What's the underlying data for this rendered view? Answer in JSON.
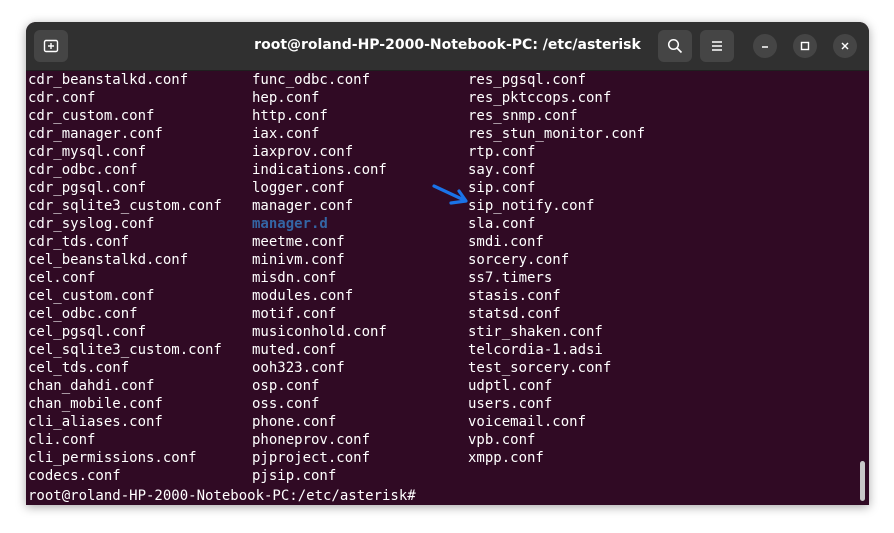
{
  "window": {
    "title": "root@roland-HP-2000-Notebook-PC: /etc/asterisk"
  },
  "icons": {
    "new_tab": "new-tab-icon",
    "search": "search-icon",
    "menu": "hamburger-menu-icon",
    "minimize": "minimize-icon",
    "maximize": "maximize-icon",
    "close": "close-icon"
  },
  "colors": {
    "terminal_bg": "#300a24",
    "titlebar_bg": "#303030",
    "directory_text": "#3465a4",
    "arrow": "#1a73e8"
  },
  "terminal": {
    "columns": [
      [
        "cdr_beanstalkd.conf",
        "cdr.conf",
        "cdr_custom.conf",
        "cdr_manager.conf",
        "cdr_mysql.conf",
        "cdr_odbc.conf",
        "cdr_pgsql.conf",
        "cdr_sqlite3_custom.conf",
        "cdr_syslog.conf",
        "cdr_tds.conf",
        "cel_beanstalkd.conf",
        "cel.conf",
        "cel_custom.conf",
        "cel_odbc.conf",
        "cel_pgsql.conf",
        "cel_sqlite3_custom.conf",
        "cel_tds.conf",
        "chan_dahdi.conf",
        "chan_mobile.conf",
        "cli_aliases.conf",
        "cli.conf",
        "cli_permissions.conf",
        "codecs.conf"
      ],
      [
        "func_odbc.conf",
        "hep.conf",
        "http.conf",
        "iax.conf",
        "iaxprov.conf",
        "indications.conf",
        "logger.conf",
        "manager.conf",
        "manager.d",
        "meetme.conf",
        "minivm.conf",
        "misdn.conf",
        "modules.conf",
        "motif.conf",
        "musiconhold.conf",
        "muted.conf",
        "ooh323.conf",
        "osp.conf",
        "oss.conf",
        "phone.conf",
        "phoneprov.conf",
        "pjproject.conf",
        "pjsip.conf"
      ],
      [
        "res_pgsql.conf",
        "res_pktccops.conf",
        "res_snmp.conf",
        "res_stun_monitor.conf",
        "rtp.conf",
        "say.conf",
        "sip.conf",
        "sip_notify.conf",
        "sla.conf",
        "smdi.conf",
        "sorcery.conf",
        "ss7.timers",
        "stasis.conf",
        "statsd.conf",
        "stir_shaken.conf",
        "telcordia-1.adsi",
        "test_sorcery.conf",
        "udptl.conf",
        "users.conf",
        "voicemail.conf",
        "vpb.conf",
        "xmpp.conf"
      ]
    ],
    "prompt": "root@roland-HP-2000-Notebook-PC:/etc/asterisk#"
  }
}
